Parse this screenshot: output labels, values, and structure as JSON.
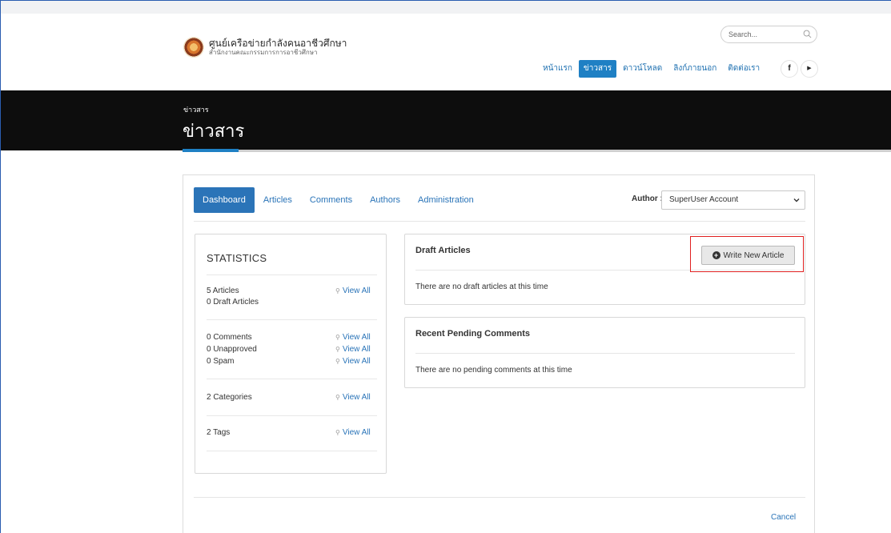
{
  "site": {
    "title": "ศูนย์เครือข่ายกำลังคนอาชีวศึกษา",
    "subtitle": "สำนักงานคณะกรรมการการอาชีวศึกษา",
    "search_placeholder": "Search..."
  },
  "nav": {
    "items": [
      {
        "label": "หน้าแรก",
        "active": false
      },
      {
        "label": "ข่าวสาร",
        "active": true
      },
      {
        "label": "ดาวน์โหลด",
        "active": false
      },
      {
        "label": "ลิงก์ภายนอก",
        "active": false
      },
      {
        "label": "ติดต่อเรา",
        "active": false
      }
    ],
    "social": [
      {
        "icon": "facebook-icon",
        "glyph": "f"
      },
      {
        "icon": "youtube-icon",
        "glyph": "▶"
      }
    ]
  },
  "banner": {
    "breadcrumb": "ข่าวสาร",
    "title": "ข่าวสาร"
  },
  "tabs": [
    "Dashboard",
    "Articles",
    "Comments",
    "Authors",
    "Administration"
  ],
  "author": {
    "label": "Author :",
    "selected": "SuperUser Account"
  },
  "statistics": {
    "heading": "STATISTICS",
    "articles": "5 Articles",
    "draft_articles": "0 Draft Articles",
    "comments": "0 Comments",
    "unapproved": "0 Unapproved",
    "spam": "0 Spam",
    "categories": "2 Categories",
    "tags": "2 Tags",
    "view_all": "View All"
  },
  "drafts": {
    "heading": "Draft Articles",
    "write_button": "Write New Article",
    "empty": "There are no draft articles at this time"
  },
  "pending": {
    "heading": "Recent Pending Comments",
    "empty": "There are no pending comments at this time"
  },
  "footer": {
    "cancel": "Cancel"
  },
  "colors": {
    "accent": "#1f80c4",
    "banner": "#0d0d0d",
    "highlight": "#e02020"
  }
}
